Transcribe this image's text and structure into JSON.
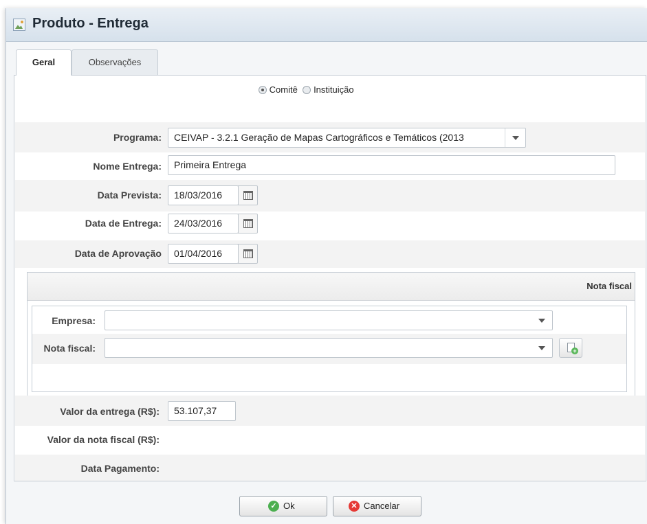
{
  "window": {
    "title": "Produto - Entrega"
  },
  "tabs": [
    {
      "label": "Geral",
      "active": true
    },
    {
      "label": "Observações",
      "active": false
    }
  ],
  "form": {
    "radio": {
      "options": [
        {
          "label": "Comitê",
          "checked": true
        },
        {
          "label": "Instituição",
          "checked": false
        }
      ]
    },
    "programa": {
      "label": "Programa:",
      "value": "CEIVAP - 3.2.1 Geração de Mapas Cartográficos e Temáticos (2013"
    },
    "nome_entrega": {
      "label": "Nome Entrega:",
      "value": "Primeira Entrega"
    },
    "data_prevista": {
      "label": "Data Prevista:",
      "value": "18/03/2016"
    },
    "data_entrega": {
      "label": "Data de Entrega:",
      "value": "24/03/2016"
    },
    "data_aprovacao": {
      "label": "Data de Aprovação",
      "value": "01/04/2016"
    },
    "nota_fiscal_section": {
      "title": "Nota fiscal",
      "empresa": {
        "label": "Empresa:",
        "value": ""
      },
      "nota_fiscal": {
        "label": "Nota fiscal:",
        "value": ""
      }
    },
    "valor_entrega": {
      "label": "Valor da entrega (R$):",
      "value": "53.107,37"
    },
    "valor_nota_fiscal": {
      "label": "Valor da nota fiscal (R$):"
    },
    "data_pagamento": {
      "label": "Data Pagamento:"
    }
  },
  "buttons": {
    "ok": {
      "label": "Ok",
      "icon": "check-icon",
      "color": "#4caf50"
    },
    "cancel": {
      "label": "Cancelar",
      "icon": "cancel-icon",
      "color": "#e53935"
    }
  }
}
